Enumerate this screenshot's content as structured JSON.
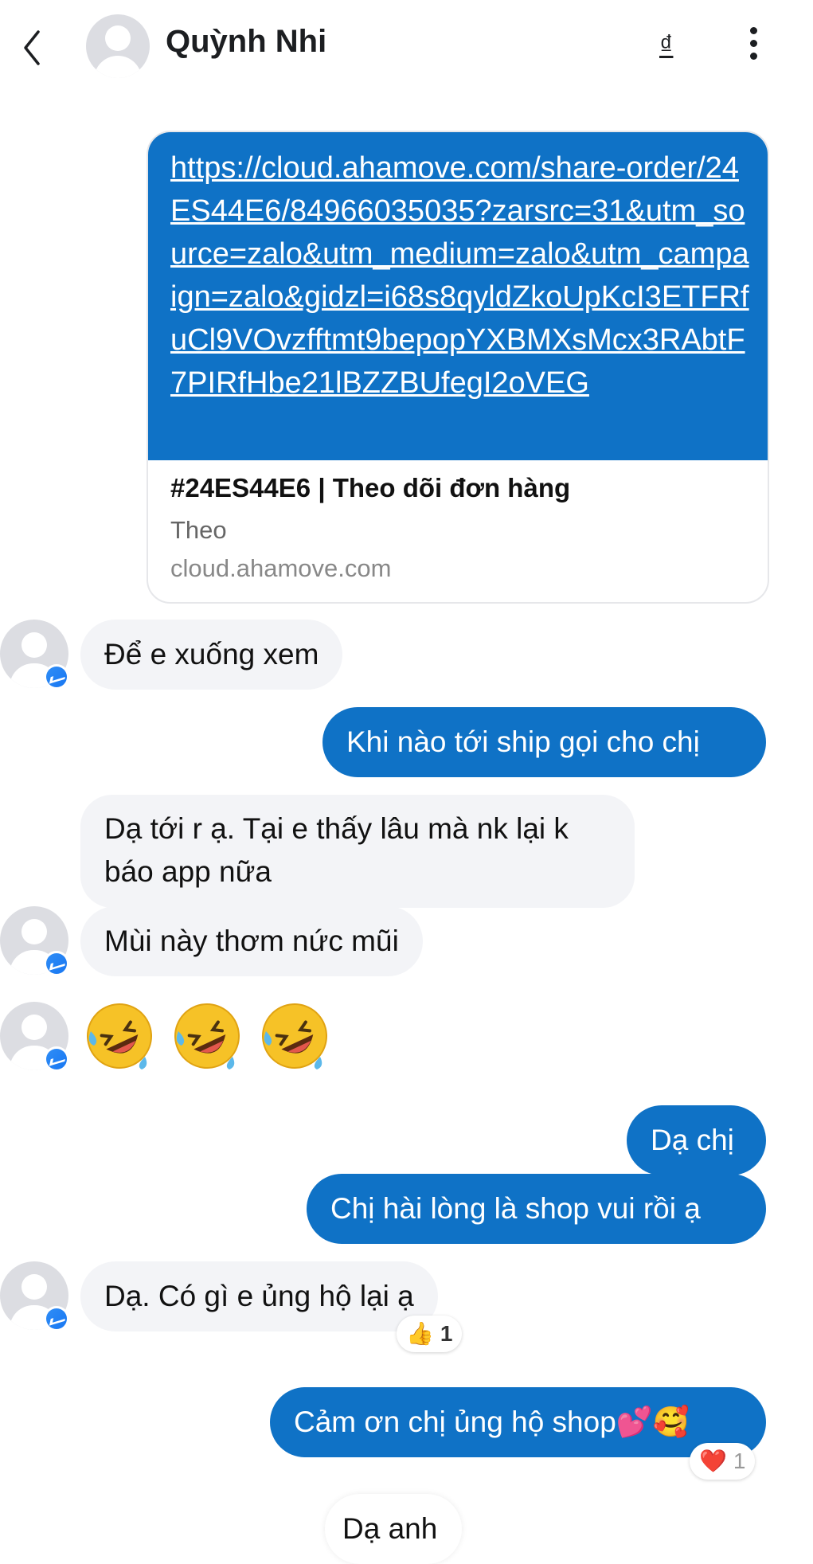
{
  "header": {
    "back_icon": "chevron-left-icon",
    "contact_name": "Quỳnh Nhi",
    "currency_symbol": "₫",
    "more_icon": "more-vertical-icon"
  },
  "link_message": {
    "url": "https://cloud.ahamove.com/share-order/24ES44E6/84966035035?zarsrc=31&utm_source=zalo&utm_medium=zalo&utm_campaign=zalo&gidzl=i68s8qyldZkoUpKcI3ETFRfuCl9VOvzfftmt9bepopYXBMXsMcx3RAbtF7PIRfHbe21lBZZBUfegI2oVEG",
    "preview_title": "#24ES44E6 | Theo dõi đơn hàng",
    "preview_description": "Theo",
    "preview_domain": "cloud.ahamove.com"
  },
  "messages": [
    {
      "id": "m1",
      "from": "them",
      "text": "Để e xuống xem"
    },
    {
      "id": "m2",
      "from": "me",
      "text": "Khi nào tới ship gọi cho chị"
    },
    {
      "id": "m3",
      "from": "them",
      "line1": "Dạ tới r ạ. Tại e thấy lâu mà nk lại k",
      "line2": "báo app nữa"
    },
    {
      "id": "m4",
      "from": "them",
      "text": "Mùi này thơm nức mũi"
    },
    {
      "id": "m5",
      "from": "them",
      "emoji": "rolling-on-floor-laughing x3"
    },
    {
      "id": "m6",
      "from": "me",
      "text": "Dạ chị"
    },
    {
      "id": "m7",
      "from": "me",
      "text": "Chị hài lòng là shop vui rồi ạ"
    },
    {
      "id": "m8",
      "from": "them",
      "text": "Dạ. Có gì e ủng hộ lại ạ",
      "reaction": {
        "emoji": "👍",
        "count": "1"
      }
    },
    {
      "id": "m9",
      "from": "me",
      "text": "Cảm ơn chị ủng hộ shop💕🥰",
      "reaction": {
        "emoji": "❤️",
        "count": "1"
      }
    },
    {
      "id": "m10",
      "from": "them",
      "text": "Dạ anh"
    }
  ],
  "colors": {
    "outgoing_bubble": "#0f72c6",
    "incoming_bubble": "#f3f4f7",
    "messenger_badge": "#1877f2"
  }
}
